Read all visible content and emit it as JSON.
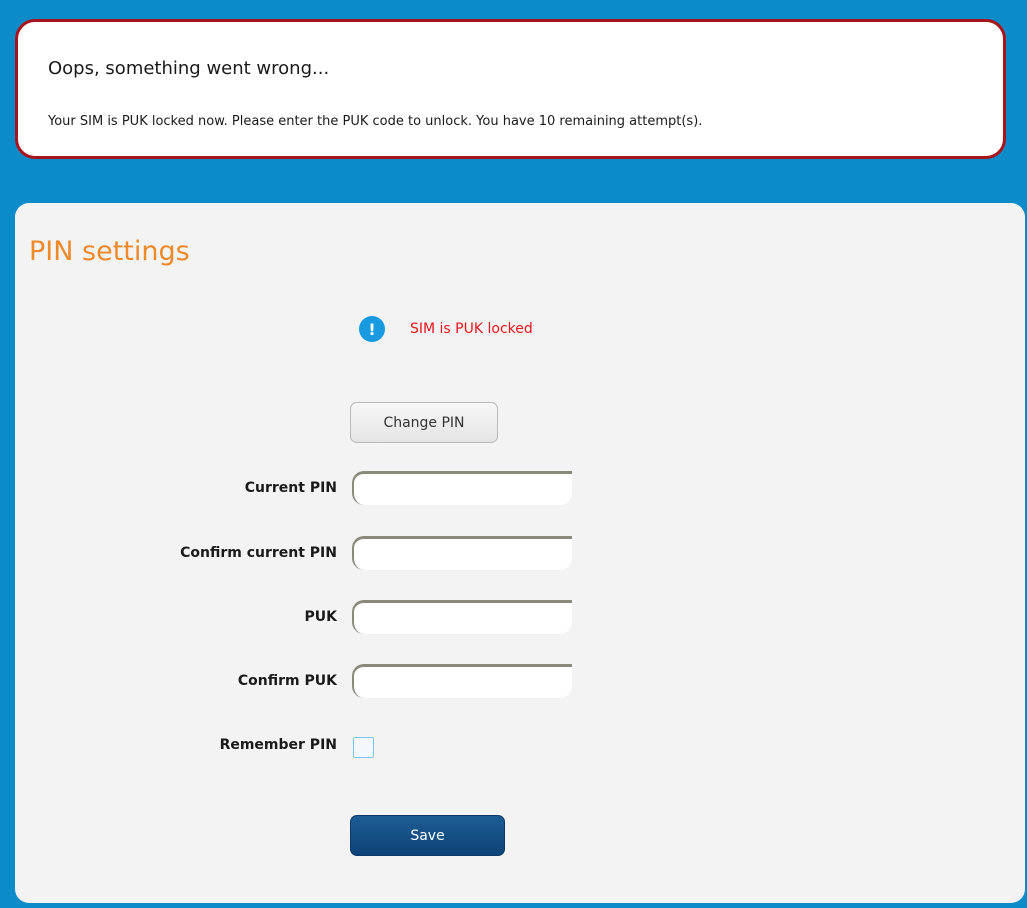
{
  "error": {
    "title": "Oops, something went wrong...",
    "message": "Your SIM is PUK locked now. Please enter the PUK code to unlock. You have 10 remaining attempt(s)."
  },
  "pin_settings": {
    "title": "PIN settings",
    "status_icon": "info-exclamation-icon",
    "status_icon_glyph": "!",
    "status_text": "SIM is PUK locked",
    "change_pin_label": "Change PIN",
    "fields": {
      "current_pin": {
        "label": "Current PIN",
        "value": ""
      },
      "confirm_current_pin": {
        "label": "Confirm current PIN",
        "value": ""
      },
      "puk": {
        "label": "PUK",
        "value": ""
      },
      "confirm_puk": {
        "label": "Confirm PUK",
        "value": ""
      }
    },
    "remember_pin": {
      "label": "Remember PIN",
      "checked": false
    },
    "save_label": "Save"
  },
  "colors": {
    "background": "#0b8bc8",
    "error_border": "#a8141c",
    "title_accent": "#ee8a2a",
    "status_text": "#e8161e",
    "info_icon": "#1a9ae0",
    "save_button": "#0d4377"
  }
}
